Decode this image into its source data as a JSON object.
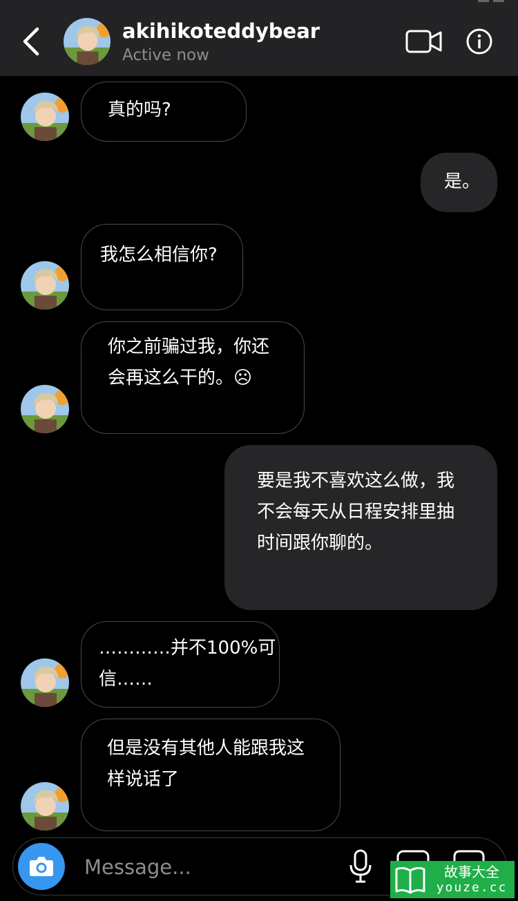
{
  "header": {
    "username": "akihikoteddybear",
    "status": "Active now"
  },
  "messages": [
    {
      "side": "in",
      "text": "真的吗?"
    },
    {
      "side": "out",
      "text": "是。"
    },
    {
      "side": "in",
      "text": "我怎么相信你?"
    },
    {
      "side": "in",
      "text": "你之前骗过我，你还\n会再这么干的。☹"
    },
    {
      "side": "out",
      "text": "要是我不喜欢这么做，我\n不会每天从日程安排里抽\n时间跟你聊的。"
    },
    {
      "side": "in",
      "text": "…………并不100%可\n信……"
    },
    {
      "side": "in",
      "text": "但是没有其他人能跟我这\n样说话了"
    }
  ],
  "composer": {
    "placeholder": "Message..."
  },
  "watermark": {
    "title": "故事大全",
    "site": "youze.cc"
  },
  "icons": [
    "back-arrow-icon",
    "video-call-icon",
    "info-icon",
    "camera-icon",
    "microphone-icon",
    "gallery-icon",
    "sticker-icon",
    "book-icon"
  ]
}
